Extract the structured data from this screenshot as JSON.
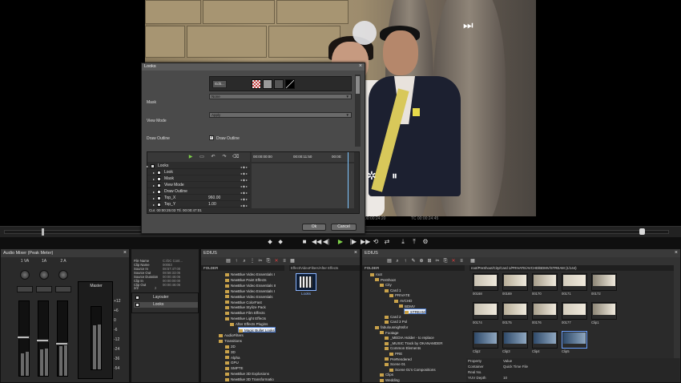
{
  "player": {
    "timecode_left": "00:00:24:20",
    "timecode_right": "TC 00:00:24:45",
    "icons": [
      "skip-next-icon",
      "asterisk-icon",
      "pause-icon"
    ]
  },
  "dialog": {
    "title": "Looks",
    "close": "×",
    "edit_label": "Edit...",
    "mask_label": "Mask",
    "mask_value": "None",
    "view_mode_label": "View Mode",
    "view_mode_value": "Apply",
    "draw_outline_label": "Draw Outline",
    "draw_outline_check": "Draw Outline",
    "ruler_start": "00:00:00:00",
    "ruler_mid": "00:00:11:50",
    "ruler_end": "00:00:",
    "tree": [
      {
        "name": "Looks"
      },
      {
        "name": "Look"
      },
      {
        "name": "Mask"
      },
      {
        "name": "View Mode"
      },
      {
        "name": "Draw Outline"
      },
      {
        "name": "Top_X",
        "value": "960.00"
      },
      {
        "name": "Top_Y",
        "value": "1.00"
      }
    ],
    "status": "Cur. 00:00:25:03  Ttl. 00:00:47:01",
    "ok_label": "Ok",
    "cancel_label": "Cancel"
  },
  "mixer": {
    "title": "Audio Mixer (Peak Meter)",
    "channels": [
      "1 VA",
      "1A",
      "2 A"
    ],
    "master": "Master",
    "scale": [
      "+12",
      "+6",
      "0",
      "-6",
      "-12",
      "-24",
      "-36",
      "-54"
    ]
  },
  "info": {
    "rows": [
      {
        "k": "File Name",
        "v": "C:/DC Cont..."
      },
      {
        "k": "Clip Name",
        "v": "00083"
      },
      {
        "k": "Source In",
        "v": "08:57:47:00"
      },
      {
        "k": "Source Out",
        "v": "08:58:33:06"
      },
      {
        "k": "Source Duration",
        "v": "00:00:46:06"
      },
      {
        "k": "Clip In",
        "v": "00:00:00:00"
      },
      {
        "k": "Clip Out",
        "v": "00:00:46:06"
      }
    ],
    "counts": [
      "2/2",
      "2"
    ]
  },
  "layouter": {
    "rows": [
      {
        "name": "Layouter",
        "sel": false
      },
      {
        "name": "Looks",
        "sel": true
      }
    ]
  },
  "effect": {
    "title": "EDIUS",
    "folder_header": "FOLDER",
    "path": "Effect/VideoFilters/After Effects",
    "tree": [
      "NewBlue Video Essentials I",
      "NewBlue Paint Effects",
      "NewBlue Video Essentials II",
      "NewBlue Video Essentials I",
      "NewBlue Video Essentials",
      "NewBlue ColorFast",
      "NewBlue Stylize Pack",
      "NewBlue Film Effects",
      "NewBlue Light Effects",
      "After Effects Plugins",
      "Magic Bullet Looks",
      "AudioFilters",
      "Transitions",
      "2D",
      "3D",
      "Alpha",
      "GPU",
      "SMPTE",
      "NewBlue 3D Explosions",
      "NewBlue 3D Transformatio"
    ],
    "looks_label": "Looks"
  },
  "bin": {
    "title": "EDIUS",
    "folder_header": "FOLDER",
    "path": "root/PreShoot/City/Card 1/PRIVATE/AVCHD/BDMV/STREAM (1/144)",
    "tree": [
      "root",
      "PreShoot",
      "City",
      "Card 1",
      "PRIVATE",
      "AVCHD",
      "BDMV",
      "STREAM",
      "Card 2",
      "Card 3 Pol",
      "fabulousnightsfor",
      "Footage",
      "_MEDIA Holder - to replace",
      "_MUSIC Track by OKANAMDER",
      "Common Elements",
      "PRE",
      "PreRendered",
      "Scene 01",
      "Scene 01's Compositions",
      "Clips",
      "Wedding"
    ],
    "thumbs_row1": [
      "00168",
      "00169",
      "00170",
      "00171",
      "00172"
    ],
    "thumbs_row2": [
      "00174",
      "00175",
      "00176",
      "00177",
      "Clip1"
    ],
    "thumbs_row3": [
      "Clip2",
      "Clip3",
      "Clip4",
      "Clip5"
    ],
    "props": [
      {
        "k": "Property",
        "v": "Value"
      },
      {
        "k": "Container",
        "v": "Quick Time File"
      },
      {
        "k": "Real No.",
        "v": ""
      },
      {
        "k": "YUV Depth",
        "v": "10"
      }
    ]
  }
}
